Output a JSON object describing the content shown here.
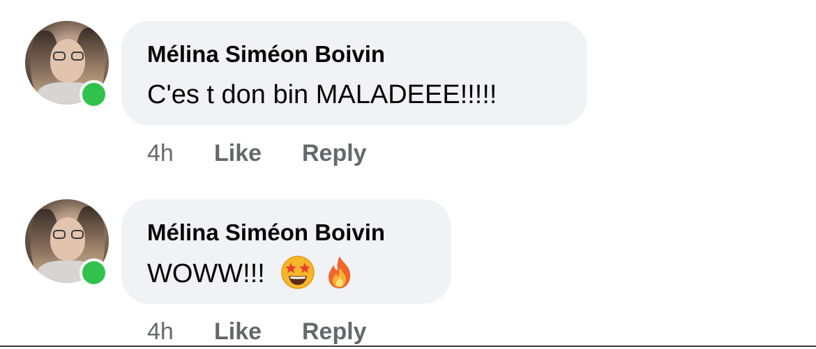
{
  "comments": [
    {
      "author": "Mélina Siméon Boivin",
      "text": "C'es t don bin MALADEEE!!!!!",
      "emojis": [],
      "time": "4h",
      "like_label": "Like",
      "reply_label": "Reply",
      "online": true
    },
    {
      "author": "Mélina Siméon Boivin",
      "text": "WOWW!!!",
      "emojis": [
        "star-struck-emoji",
        "fire-emoji"
      ],
      "time": "4h",
      "like_label": "Like",
      "reply_label": "Reply",
      "online": true
    }
  ],
  "colors": {
    "bubble_bg": "#f0f2f5",
    "text": "#050505",
    "meta": "#65676b",
    "online": "#31c24d"
  }
}
